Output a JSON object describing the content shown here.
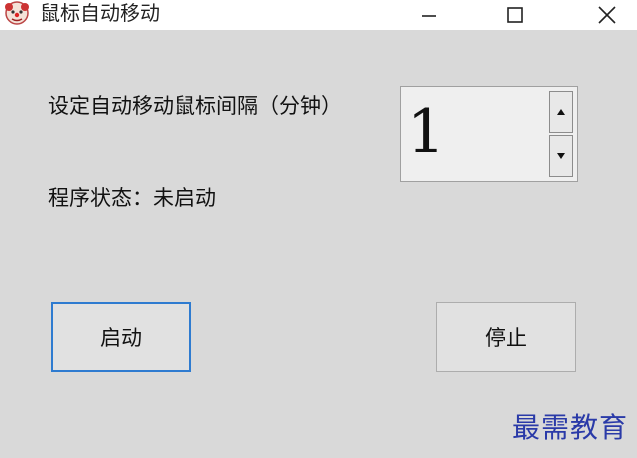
{
  "window": {
    "title": "鼠标自动移动"
  },
  "settings": {
    "interval_label": "设定自动移动鼠标间隔（分钟）",
    "interval_value": "1"
  },
  "status": {
    "text": "程序状态：未启动"
  },
  "buttons": {
    "start_label": "启动",
    "stop_label": "停止"
  },
  "watermark": {
    "text": "最需教育"
  },
  "colors": {
    "focus_border": "#2e7bd0",
    "watermark": "#2a3aa8",
    "background": "#d9d9d9"
  }
}
